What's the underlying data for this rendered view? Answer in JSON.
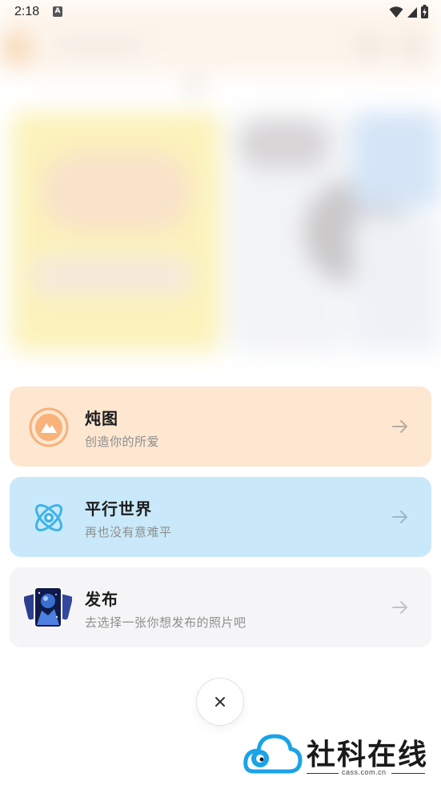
{
  "status_bar": {
    "time": "2:18",
    "notification_glyph": "A",
    "icons": [
      "wifi-icon",
      "signal-icon",
      "battery-icon"
    ]
  },
  "menu": {
    "items": [
      {
        "title": "炖图",
        "subtitle": "创造你的所爱",
        "icon": "mountain-image-icon",
        "color": "#fde7d1",
        "accent": "#f5a96b"
      },
      {
        "title": "平行世界",
        "subtitle": "再也没有意难平",
        "icon": "atom-icon",
        "color": "#c9e9fa",
        "accent": "#3fb3e8"
      },
      {
        "title": "发布",
        "subtitle": "去选择一张你想发布的照片吧",
        "icon": "photo-stack-icon",
        "color": "#f5f5f7",
        "accent": "#1a2a6c"
      }
    ]
  },
  "close_button": {
    "icon": "close-icon",
    "glyph": "×"
  },
  "watermark": {
    "text": "社科在线",
    "url": "cass.com.cn",
    "color": "#1aa3e8"
  }
}
